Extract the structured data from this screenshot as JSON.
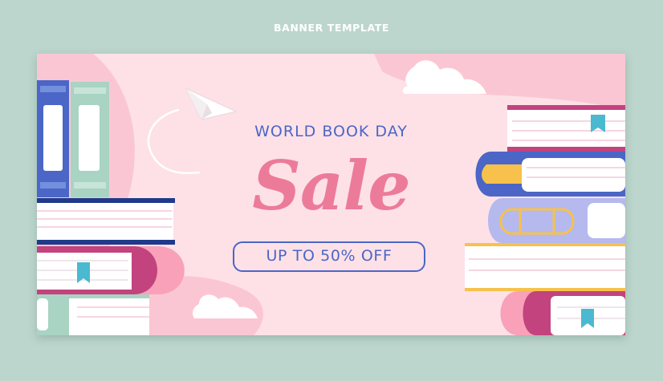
{
  "header": {
    "label": "BANNER TEMPLATE"
  },
  "banner": {
    "eyebrow": "WORLD BOOK DAY",
    "headline": "Sale",
    "offer": "UP TO 50% OFF"
  },
  "icons": [
    "paper-plane-icon",
    "cloud-icon",
    "bookmark-icon",
    "book-stack-icon"
  ],
  "colors": {
    "outer_background": "#bcd6cd",
    "banner_background": "#fde1e7",
    "blob_pink": "#fbc6d3",
    "accent_blue": "#4b66c6",
    "sale_pink": "#ec7b9a",
    "book_green": "#a9d3c3",
    "book_magenta": "#c2437e",
    "book_lavender": "#b5b9ee",
    "book_yellow": "#f7c14c",
    "bookmark_teal": "#4bb9cf"
  }
}
